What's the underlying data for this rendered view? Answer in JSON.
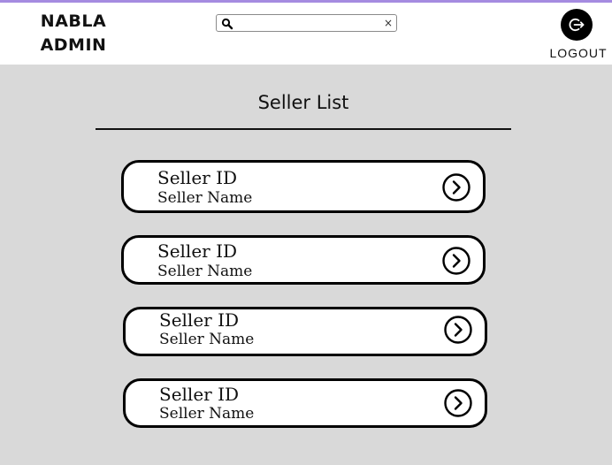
{
  "header": {
    "brand_line1": "NABLA",
    "brand_line2": "ADMIN",
    "search": {
      "value": "",
      "placeholder": "",
      "clear_label": "×"
    },
    "logout_label": "LOGOUT"
  },
  "main": {
    "title": "Seller List",
    "sellers": [
      {
        "id_label": "Seller ID",
        "name_label": "Seller Name"
      },
      {
        "id_label": "Seller ID",
        "name_label": "Seller Name"
      },
      {
        "id_label": "Seller ID",
        "name_label": "Seller Name"
      },
      {
        "id_label": "Seller ID",
        "name_label": "Seller Name"
      }
    ]
  },
  "colors": {
    "accent_line": "#a58be0",
    "background": "#d9d9d9",
    "header": "#ffffff"
  },
  "icons": [
    "search-icon",
    "clear-icon",
    "logout-icon",
    "chevron-right-circle-icon"
  ]
}
